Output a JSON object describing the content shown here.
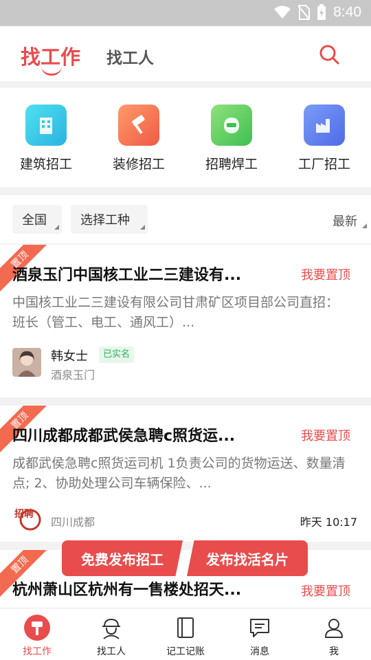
{
  "status_bar": {
    "time": "8:40"
  },
  "header": {
    "active_tab": "找工作",
    "other_tab": "找工人"
  },
  "categories": [
    {
      "label": "建筑招工",
      "icon": "building-icon",
      "color": "#3cc6e6"
    },
    {
      "label": "装修招工",
      "icon": "paint-roller-icon",
      "color": "#f2744f"
    },
    {
      "label": "招聘焊工",
      "icon": "welding-mask-icon",
      "color": "#5ccf5c"
    },
    {
      "label": "工厂招工",
      "icon": "factory-icon",
      "color": "#5b7cf0"
    }
  ],
  "filters": {
    "region": "全国",
    "trade": "选择工种",
    "sort": "最新"
  },
  "jobs": [
    {
      "ribbon": "置顶",
      "title": "酒泉玉门中国核工业二三建设有...",
      "pin": "我要置顶",
      "desc": "中国核工业二三建设有限公司甘肃矿区项目部公司直招： 班长（管工、电工、通风工）...",
      "poster": "韩女士",
      "verified": "已实名",
      "location": "酒泉玉门"
    },
    {
      "ribbon": "置顶",
      "title": "四川成都成都武侯急聘c照货运...",
      "pin": "我要置顶",
      "desc": "成都武侯急聘c照货运司机 1负责公司的货物运送、数量清点; 2、协助处理公司车辆保险、...",
      "location": "四川成都",
      "time": "昨天 10:17",
      "logo_text": "招聘"
    },
    {
      "ribbon": "置顶",
      "title": "杭州萧山区杭州有一售楼处招天...",
      "pin": "我要置顶"
    }
  ],
  "fab": {
    "post_job": "免费发布招工",
    "post_card": "发布找活名片"
  },
  "tabbar": [
    {
      "label": "找工作",
      "icon": "job-hammer-icon",
      "active": true
    },
    {
      "label": "找工人",
      "icon": "worker-helmet-icon",
      "active": false
    },
    {
      "label": "记工记账",
      "icon": "notebook-icon",
      "active": false
    },
    {
      "label": "消息",
      "icon": "message-icon",
      "active": false
    },
    {
      "label": "我",
      "icon": "profile-icon",
      "active": false
    }
  ],
  "colors": {
    "accent": "#e84c4c",
    "verified": "#2fb05a"
  }
}
